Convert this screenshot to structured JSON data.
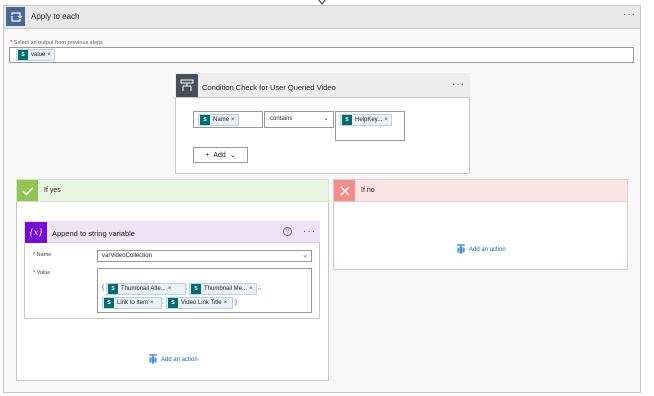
{
  "apply_to_each": {
    "title": "Apply to each",
    "more_label": "···",
    "select_label": "Select an output from previous steps",
    "required_marker": "*",
    "select_token": "value"
  },
  "condition": {
    "title": "Condition Check for User Queried Video",
    "more_label": "···",
    "left_token": "Name",
    "operator": "contains",
    "right_token": "HelpKey...",
    "add_label": "Add"
  },
  "if_yes": {
    "title": "If yes",
    "add_action_label": "Add an action"
  },
  "if_no": {
    "title": "If no",
    "add_action_label": "Add an action"
  },
  "append": {
    "title": "Append to string variable",
    "help_label": "?",
    "more_label": "···",
    "name_label": "Name",
    "name_value": "varVideoCollection",
    "value_label": "Value",
    "tokens": [
      "Thumbnail Alte...",
      "Thumbnail Me...",
      "Link to Item",
      "Video Link Title"
    ],
    "open_brace": "{",
    "sep1": ";",
    "sep2": ";;",
    "sep3": ";",
    "close_brace": "}"
  },
  "colors": {
    "apply_icon": "#486991",
    "condition_icon": "#484f58",
    "yes_icon": "#92c353",
    "no_icon": "#f08d8d",
    "variable_icon": "#770bd6",
    "sharepoint_token": "#036c70",
    "link": "#0064c8"
  }
}
